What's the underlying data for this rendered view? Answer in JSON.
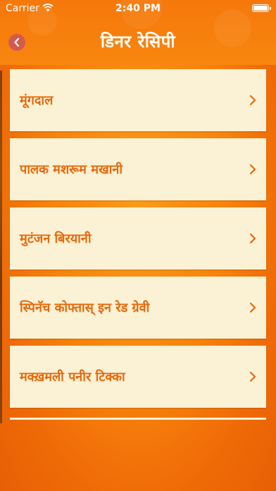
{
  "status_bar": {
    "carrier": "Carrier",
    "time": "2:40 PM"
  },
  "nav": {
    "title": "डिनर रेसिपी",
    "back_icon": "chevron-left-icon"
  },
  "recipes": [
    {
      "label": "मूंगदाल"
    },
    {
      "label": "पालक मशरूम मखानी"
    },
    {
      "label": "मुटंजन बिरयानी"
    },
    {
      "label": "स्पिनॅच कोफ्तास् इन रेड ग्रेवी"
    },
    {
      "label": "मक्ख़मली पनीर टिक्का"
    }
  ],
  "colors": {
    "accent": "#e8680a",
    "card_bg": "#fbf2d5",
    "back_button": "#d45a4f",
    "background": "#f7830c"
  }
}
